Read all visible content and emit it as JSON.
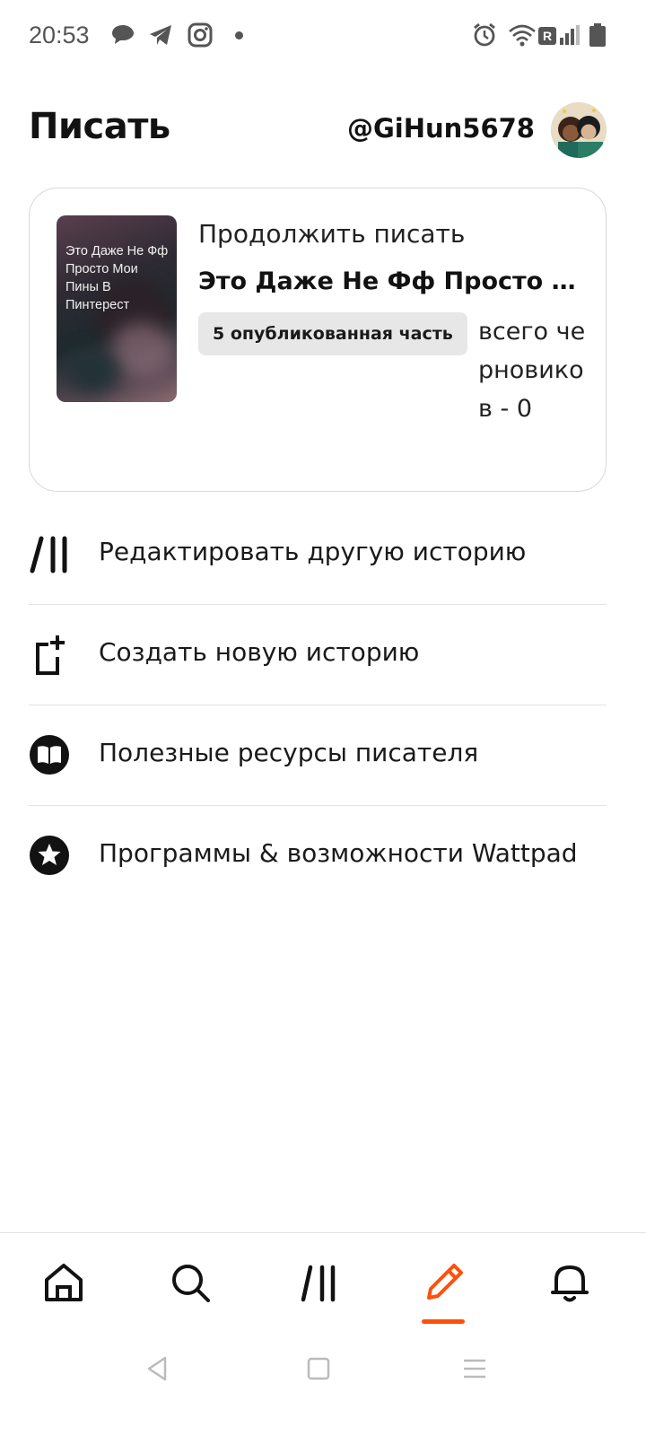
{
  "status_bar": {
    "time": "20:53",
    "left_icons": [
      "chat-bubble-icon",
      "telegram-icon",
      "instagram-icon",
      "dot-icon"
    ],
    "right_icons": [
      "alarm-icon",
      "wifi-icon",
      "roaming-icon",
      "signal-icon",
      "battery-icon"
    ],
    "roaming_letter": "R"
  },
  "header": {
    "title": "Писать",
    "username": "@GiHun5678"
  },
  "continue_card": {
    "label": "Продолжить писать",
    "story_title": "Это Даже Не Фф Просто Мои Пины В Пинтерест",
    "cover_text": "Это Даже Не Фф Просто Мои Пины В Пинтерест",
    "published_parts": "5 опубликованная часть",
    "drafts": "всего черновиков - 0"
  },
  "menu": {
    "items": [
      {
        "label": "Редактировать другую историю",
        "icon": "library-icon"
      },
      {
        "label": "Создать новую историю",
        "icon": "new-story-icon"
      },
      {
        "label": "Полезные ресурсы писателя",
        "icon": "book-icon"
      },
      {
        "label": "Программы & возможности Wattpad",
        "icon": "star-icon"
      }
    ]
  },
  "bottom_nav": {
    "items": [
      "home-icon",
      "search-icon",
      "library-icon",
      "write-icon",
      "notifications-icon"
    ],
    "active": "write-icon"
  },
  "colors": {
    "accent": "#ff500a",
    "text": "#121212",
    "divider": "#e3e3e3",
    "badge_bg": "#e7e7e7"
  }
}
